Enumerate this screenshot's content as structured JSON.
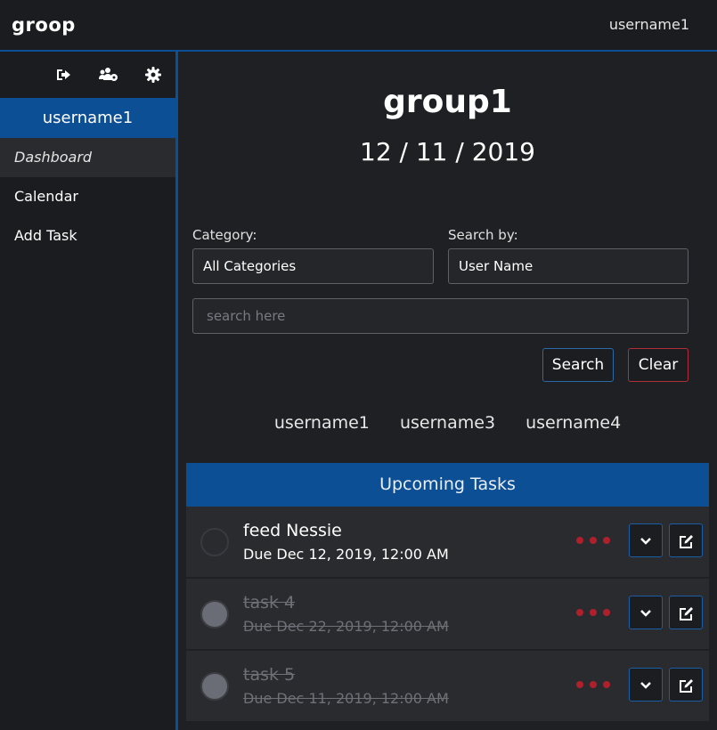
{
  "topbar": {
    "brand": "groop",
    "user": "username1"
  },
  "sidebar": {
    "icons": [
      "sign-out-icon",
      "users-cog-icon",
      "gear-icon"
    ],
    "user": "username1",
    "items": [
      {
        "label": "Dashboard",
        "active": true
      },
      {
        "label": "Calendar",
        "active": false
      },
      {
        "label": "Add Task",
        "active": false
      }
    ]
  },
  "main": {
    "group_name": "group1",
    "date": "12 / 11 / 2019",
    "category_label": "Category:",
    "category_value": "All Categories",
    "searchby_label": "Search by:",
    "searchby_value": "User Name",
    "search_placeholder": "search here",
    "search_button": "Search",
    "clear_button": "Clear",
    "members": [
      "username1",
      "username3",
      "username4"
    ],
    "tasks_header": "Upcoming Tasks",
    "tasks": [
      {
        "name": "feed Nessie",
        "due": "Due Dec 12, 2019, 12:00 AM",
        "completed": false
      },
      {
        "name": "task 4",
        "due": "Due Dec 22, 2019, 12:00 AM",
        "completed": true
      },
      {
        "name": "task 5",
        "due": "Due Dec 11, 2019, 12:00 AM",
        "completed": true
      }
    ]
  },
  "colors": {
    "accent": "#0d4f95",
    "danger": "#b0202c",
    "background": "#1f2023"
  }
}
